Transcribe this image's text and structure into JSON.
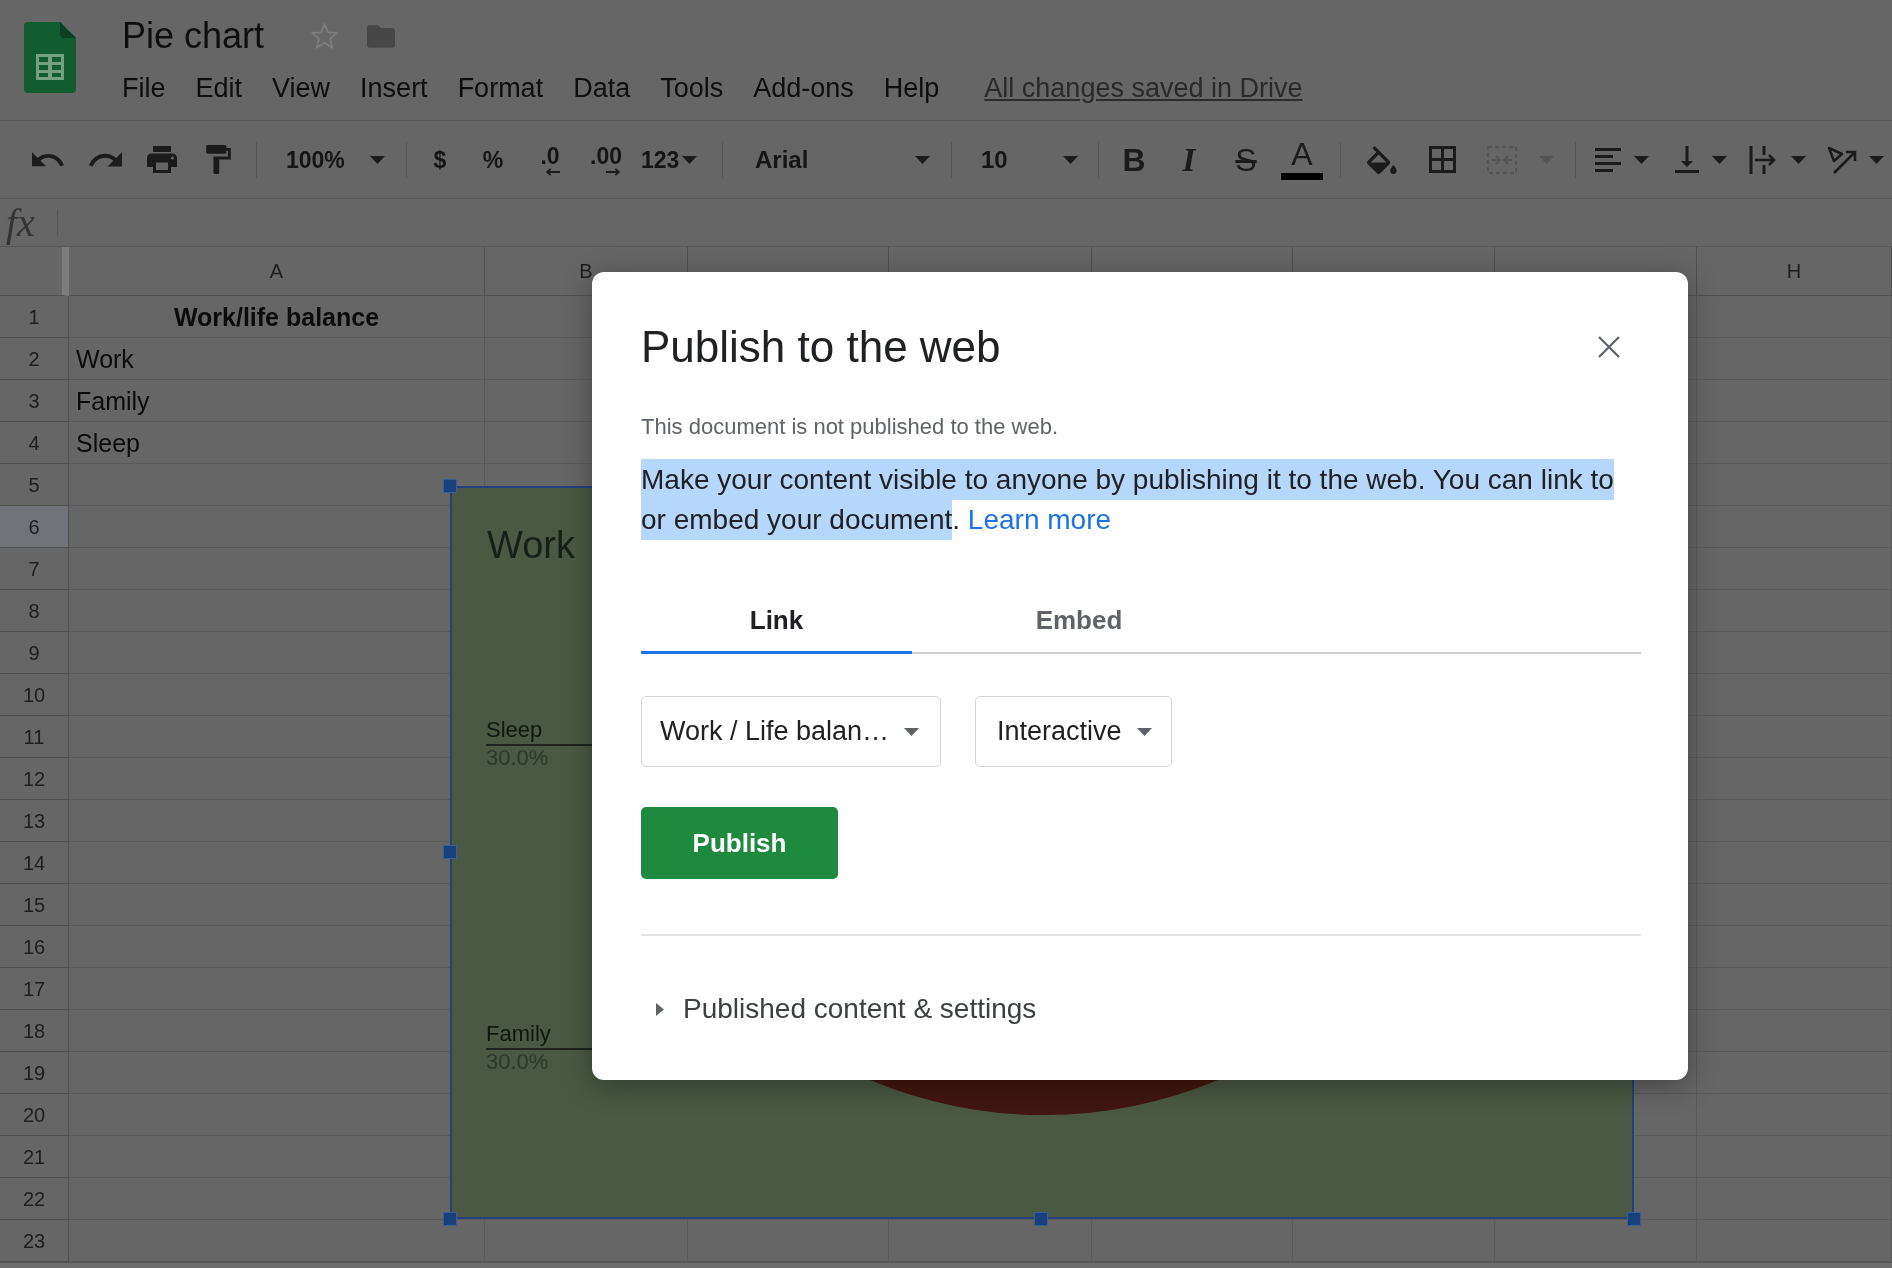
{
  "header": {
    "document_title": "Pie chart",
    "starred": false,
    "menu": [
      "File",
      "Edit",
      "View",
      "Insert",
      "Format",
      "Data",
      "Tools",
      "Add-ons",
      "Help"
    ],
    "save_status": "All changes saved in Drive"
  },
  "toolbar": {
    "zoom": "100%",
    "currency": "$",
    "percent": "%",
    "decrease_decimals": ".0",
    "increase_decimals": ".00",
    "more_formats": "123",
    "font": "Arial",
    "font_size": "10",
    "bold": "B",
    "italic": "I",
    "strikethrough": "S",
    "text_color": "A",
    "merge_disabled": true
  },
  "formula_bar": {
    "label": "fx"
  },
  "grid": {
    "columns": [
      {
        "label": "A"
      },
      {
        "label": "B"
      },
      {
        "label": "H"
      }
    ],
    "rows": [
      {
        "number": "1",
        "selected": false,
        "cells": [
          {
            "text": "Work/life balance",
            "bold": true,
            "centered": true
          }
        ]
      },
      {
        "number": "2",
        "selected": false,
        "cells": [
          {
            "text": "Work",
            "bold": false,
            "centered": false
          }
        ]
      },
      {
        "number": "3",
        "selected": false,
        "cells": [
          {
            "text": "Family",
            "bold": false,
            "centered": false
          }
        ]
      },
      {
        "number": "4",
        "selected": false,
        "cells": [
          {
            "text": "Sleep",
            "bold": false,
            "centered": false
          }
        ]
      },
      {
        "number": "5",
        "selected": false
      },
      {
        "number": "6",
        "selected": true
      },
      {
        "number": "7",
        "selected": false
      },
      {
        "number": "8",
        "selected": false
      },
      {
        "number": "9",
        "selected": false
      },
      {
        "number": "10",
        "selected": false
      },
      {
        "number": "11",
        "selected": false
      },
      {
        "number": "12",
        "selected": false
      },
      {
        "number": "13",
        "selected": false
      },
      {
        "number": "14",
        "selected": false
      },
      {
        "number": "15",
        "selected": false
      },
      {
        "number": "16",
        "selected": false
      },
      {
        "number": "17",
        "selected": false
      },
      {
        "number": "18",
        "selected": false
      },
      {
        "number": "19",
        "selected": false
      },
      {
        "number": "20",
        "selected": false
      },
      {
        "number": "21",
        "selected": false
      },
      {
        "number": "22",
        "selected": false
      },
      {
        "number": "23",
        "selected": false
      }
    ]
  },
  "chart": {
    "selected": true,
    "title": "Work",
    "labels": [
      {
        "name": "Sleep",
        "value": "30.0%"
      },
      {
        "name": "Family",
        "value": "30.0%"
      }
    ]
  },
  "dialog": {
    "title": "Publish to the web",
    "status": "This document is not published to the web.",
    "description": {
      "segments": [
        {
          "text": "Make your content visible to anyone by publishing it to the web. You can link to or embed your document",
          "highlighted": true
        },
        {
          "text": ".",
          "highlighted": false
        }
      ],
      "link": "Learn more"
    },
    "tabs": [
      {
        "label": "Link",
        "selected": true
      },
      {
        "label": "Embed",
        "selected": false
      }
    ],
    "dropdowns": [
      {
        "value": "Work / Life balan…"
      },
      {
        "value": "Interactive"
      }
    ],
    "publish_button": "Publish",
    "section": {
      "label": "Published content & settings",
      "expanded": false
    }
  }
}
